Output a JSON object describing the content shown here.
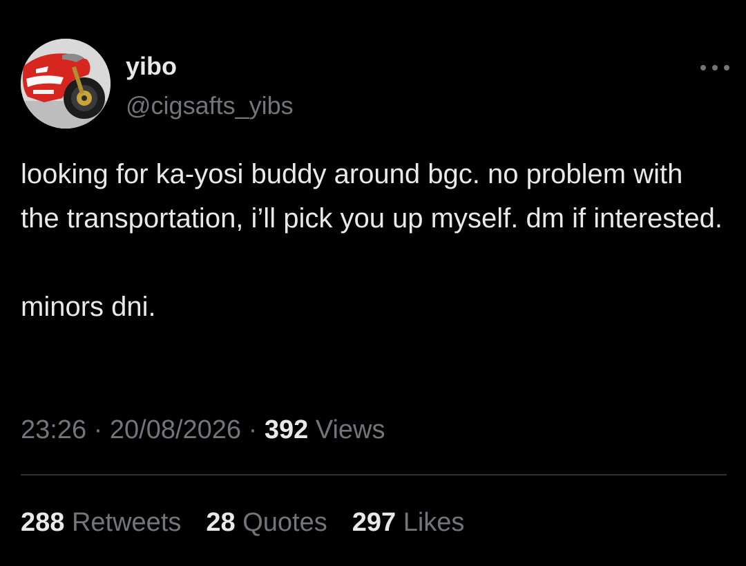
{
  "author": {
    "display_name": "yibo",
    "handle": "@cigsafts_yibs",
    "avatar_icon": "motorcycle-avatar-icon"
  },
  "tweet": {
    "paragraphs": [
      "looking for ka-yosi buddy around bgc. no problem with the transportation, i’ll pick you up myself. dm if interested.",
      "minors dni."
    ],
    "time": "23:26",
    "separator": "·",
    "date": "20/08/2026",
    "views_count": "392",
    "views_label": "Views"
  },
  "stats": {
    "retweets_count": "288",
    "retweets_label": "Retweets",
    "quotes_count": "28",
    "quotes_label": "Quotes",
    "likes_count": "297",
    "likes_label": "Likes"
  },
  "colors": {
    "background": "#000000",
    "primary_text": "#e7e9ea",
    "secondary_text": "#71767b",
    "divider": "#2f3336"
  }
}
